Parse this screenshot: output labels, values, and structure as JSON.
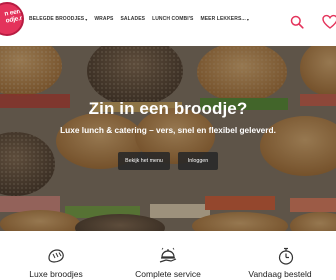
{
  "logo": {
    "text_line1": "n een",
    "text_line2": "odje.nl"
  },
  "nav": {
    "items": [
      {
        "label": "Belegde broodjes",
        "has_dropdown": true
      },
      {
        "label": "Wraps",
        "has_dropdown": false
      },
      {
        "label": "Salades",
        "has_dropdown": false
      },
      {
        "label": "Lunch combi's",
        "has_dropdown": false
      },
      {
        "label": "Meer lekkers...",
        "has_dropdown": true
      }
    ],
    "icons": [
      "search-icon",
      "heart-icon"
    ]
  },
  "hero": {
    "title": "Zin in een broodje?",
    "subtitle": "Luxe lunch & catering – vers, snel en flexibel geleverd.",
    "buttons": {
      "menu": "Bekijk het menu",
      "login": "Inloggen"
    }
  },
  "features": [
    {
      "icon": "bread-icon",
      "label": "Luxe broodjes"
    },
    {
      "icon": "service-tray-icon",
      "label": "Complete service"
    },
    {
      "icon": "stopwatch-icon",
      "label": "Vandaag besteld"
    }
  ],
  "colors": {
    "brand": "#e4335b",
    "text": "#333333",
    "button_bg": "#282828"
  }
}
